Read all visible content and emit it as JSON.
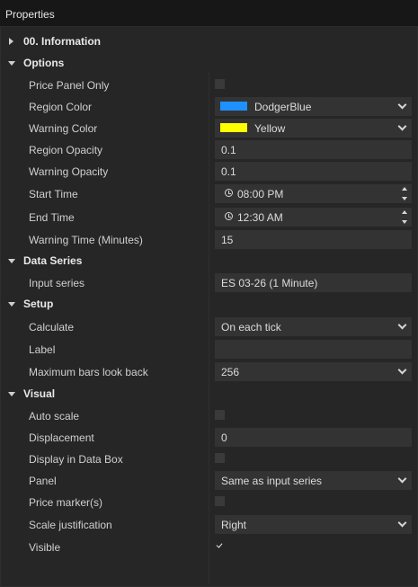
{
  "window": {
    "title": "Properties"
  },
  "categories": {
    "information": {
      "label": "00. Information",
      "expanded": false
    },
    "options": {
      "label": "Options",
      "expanded": true
    },
    "data_series": {
      "label": "Data Series",
      "expanded": true
    },
    "setup": {
      "label": "Setup",
      "expanded": true
    },
    "visual": {
      "label": "Visual",
      "expanded": true
    }
  },
  "options": {
    "price_panel_only": {
      "label": "Price Panel Only",
      "checked": false
    },
    "region_color": {
      "label": "Region Color",
      "value": "DodgerBlue",
      "swatch": "#1e90ff"
    },
    "warning_color": {
      "label": "Warning Color",
      "value": "Yellow",
      "swatch": "#ffff00"
    },
    "region_opacity": {
      "label": "Region Opacity",
      "value": "0.1"
    },
    "warning_opacity": {
      "label": "Warning Opacity",
      "value": "0.1"
    },
    "start_time": {
      "label": "Start Time",
      "value": "08:00 PM"
    },
    "end_time": {
      "label": "End Time",
      "value": "12:30 AM"
    },
    "warning_time": {
      "label": "Warning Time (Minutes)",
      "value": "15"
    }
  },
  "data_series": {
    "input_series": {
      "label": "Input series",
      "value": "ES 03-26 (1 Minute)"
    }
  },
  "setup": {
    "calculate": {
      "label": "Calculate",
      "value": "On each tick"
    },
    "label": {
      "label": "Label",
      "value": ""
    },
    "max_bars": {
      "label": "Maximum bars look back",
      "value": "256"
    }
  },
  "visual": {
    "auto_scale": {
      "label": "Auto scale",
      "checked": false
    },
    "displacement": {
      "label": "Displacement",
      "value": "0"
    },
    "display_in_data_box": {
      "label": "Display in Data Box",
      "checked": false
    },
    "panel": {
      "label": "Panel",
      "value": "Same as input series"
    },
    "price_markers": {
      "label": "Price marker(s)",
      "checked": false
    },
    "scale_justification": {
      "label": "Scale justification",
      "value": "Right"
    },
    "visible": {
      "label": "Visible",
      "checked": true
    }
  }
}
